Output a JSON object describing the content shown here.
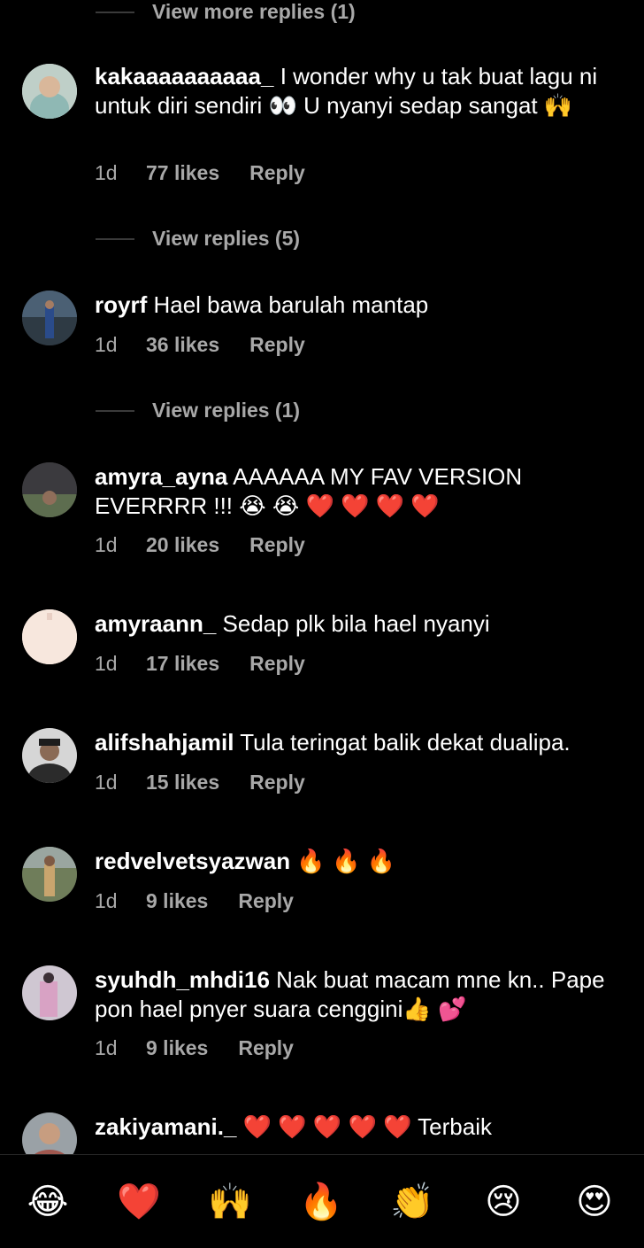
{
  "view_more_top": "View more replies (1)",
  "comments": [
    {
      "user": "kakaaaaaaaaaa_",
      "text": "I wonder why u tak buat lagu ni untuk diri sendiri 👀 U nyanyi sedap sangat 🙌",
      "time": "1d",
      "likes": "77 likes",
      "reply": "Reply",
      "view": "View replies (5)"
    },
    {
      "user": "royrf",
      "text": "Hael bawa barulah mantap",
      "time": "1d",
      "likes": "36 likes",
      "reply": "Reply",
      "view": "View replies (1)"
    },
    {
      "user": "amyra_ayna",
      "text": "AAAAAA MY FAV VERSION EVERRRR !!! 😭 😭 ❤️ ❤️ ❤️ ❤️",
      "time": "1d",
      "likes": "20 likes",
      "reply": "Reply"
    },
    {
      "user": "amyraann_",
      "text": "Sedap plk bila hael nyanyi",
      "time": "1d",
      "likes": "17 likes",
      "reply": "Reply"
    },
    {
      "user": "alifshahjamil",
      "text": "Tula teringat balik dekat dualipa.",
      "time": "1d",
      "likes": "15 likes",
      "reply": "Reply"
    },
    {
      "user": "redvelvetsyazwan",
      "text": "🔥 🔥 🔥",
      "time": "1d",
      "likes": "9 likes",
      "reply": "Reply"
    },
    {
      "user": "syuhdh_mhdi16",
      "text": "Nak buat macam mne kn.. Pape pon hael pnyer suara cenggini👍 💕",
      "time": "1d",
      "likes": "9 likes",
      "reply": "Reply"
    },
    {
      "user": "zakiyamani._",
      "text": "❤️ ❤️ ❤️ ❤️ ❤️  Terbaik"
    }
  ],
  "emoji_bar": [
    "😂",
    "❤️",
    "🙌",
    "🔥",
    "👏",
    "😢",
    "😍"
  ],
  "colors": {
    "bg": "#000000",
    "muted": "#a8a8a8",
    "divider": "#262626"
  }
}
